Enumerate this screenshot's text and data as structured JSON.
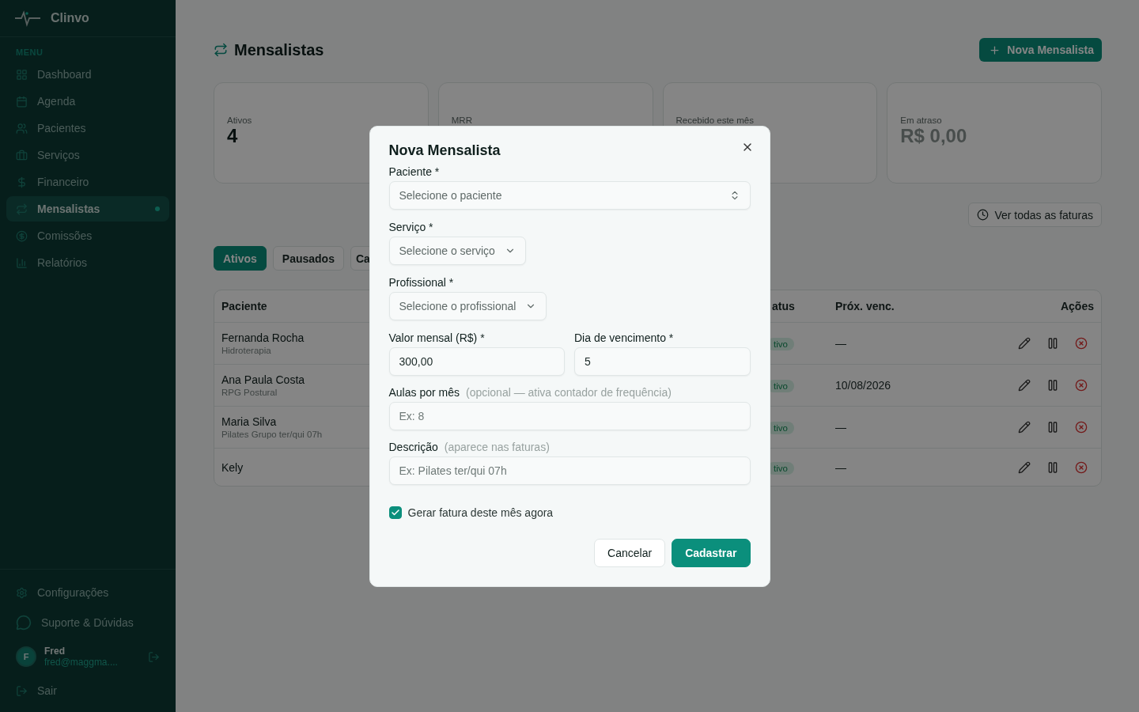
{
  "sidebar": {
    "brand": "Clinvo",
    "section_label": "MENU",
    "items": [
      {
        "label": "Dashboard",
        "selected": false
      },
      {
        "label": "Agenda",
        "selected": false
      },
      {
        "label": "Pacientes",
        "selected": false
      },
      {
        "label": "Serviços",
        "selected": false
      },
      {
        "label": "Financeiro",
        "selected": false
      },
      {
        "label": "Mensalistas",
        "selected": true
      },
      {
        "label": "Comissões",
        "selected": false
      },
      {
        "label": "Relatórios",
        "selected": false
      }
    ],
    "footer_items": [
      {
        "label": "Configurações"
      },
      {
        "label": "Suporte & Dúvidas"
      }
    ],
    "user": {
      "initial": "F",
      "name": "Fred",
      "email": "fred@maggma...."
    },
    "logout": "Sair"
  },
  "page": {
    "title": "Mensalistas",
    "new_button": "Nova Mensalista",
    "stats": [
      {
        "label": "Ativos",
        "value": "4",
        "muted": false
      },
      {
        "label": "MRR"
      },
      {
        "label": "Recebido este mês"
      },
      {
        "label": "Em atraso",
        "value": "R$ 0,00",
        "muted": true
      }
    ],
    "invoices_button": "Ver todas as faturas",
    "tabs": [
      {
        "label": "Ativos",
        "selected": true
      },
      {
        "label": "Pausados",
        "selected": false
      },
      {
        "label": "Ca",
        "selected": false
      }
    ],
    "table": {
      "columns": [
        "Paciente",
        "atus",
        "Próx. venc.",
        "Ações"
      ],
      "rows": [
        {
          "name": "Fernanda Rocha",
          "service": "Hidroterapia",
          "status": "tivo",
          "next_due": "—"
        },
        {
          "name": "Ana Paula Costa",
          "service": "RPG Postural",
          "status": "tivo",
          "next_due": "10/08/2026"
        },
        {
          "name": "Maria Silva",
          "service": "Pilates Grupo ter/qui 07h",
          "status": "tivo",
          "next_due": "—"
        },
        {
          "name": "Kely",
          "status": "tivo",
          "next_due": "—"
        }
      ]
    }
  },
  "modal": {
    "title": "Nova Mensalista",
    "fields": [
      {
        "kind": "combobox",
        "label": "Paciente *",
        "placeholder": "Selecione o paciente"
      },
      {
        "kind": "select",
        "label": "Serviço *",
        "placeholder": "Selecione o serviço"
      },
      {
        "kind": "select",
        "label": "Profissional *",
        "placeholder": "Selecione o profissional"
      },
      {
        "kind": "pair",
        "items": [
          {
            "label": "Valor mensal (R$) *",
            "value": "300,00"
          },
          {
            "label": "Dia de vencimento *",
            "value": "5"
          }
        ]
      },
      {
        "kind": "input",
        "label": "Aulas por mês",
        "hint": "(opcional — ativa contador de frequência)",
        "placeholder": "Ex: 8"
      },
      {
        "kind": "input",
        "label": "Descrição",
        "hint": "(aparece nas faturas)",
        "placeholder": "Ex: Pilates ter/qui 07h"
      }
    ],
    "checkbox": {
      "label": "Gerar fatura deste mês agora",
      "checked": true
    },
    "buttons": [
      {
        "label": "Cancelar",
        "kind": "secondary"
      },
      {
        "label": "Cadastrar",
        "kind": "primary"
      }
    ]
  }
}
